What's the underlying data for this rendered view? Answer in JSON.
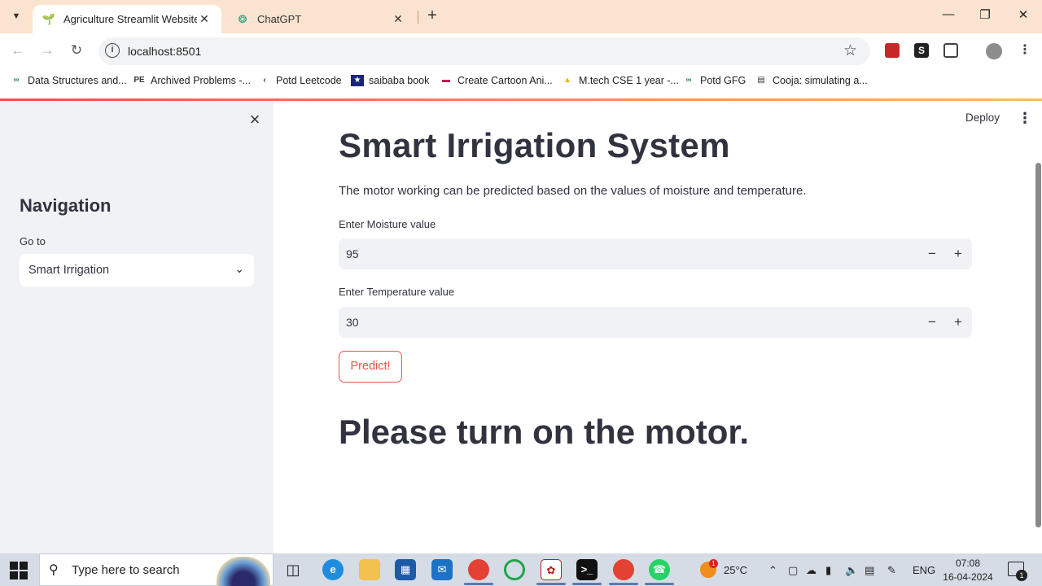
{
  "browser": {
    "tabs": [
      {
        "label": "Agriculture Streamlit Website",
        "active": true,
        "icon": "sprout-icon"
      },
      {
        "label": "ChatGPT",
        "active": false,
        "icon": "openai-icon"
      }
    ],
    "new_tab": "+",
    "url": "localhost:8501",
    "bookmarks": [
      {
        "label": "Data Structures and...",
        "icon": "gfg-icon"
      },
      {
        "label": "Archived Problems -...",
        "icon": "pe-icon"
      },
      {
        "label": "Potd Leetcode",
        "icon": "leetcode-icon"
      },
      {
        "label": "saibaba book",
        "icon": "book-icon"
      },
      {
        "label": "Create Cartoon Ani...",
        "icon": "cartoon-icon"
      },
      {
        "label": "M.tech CSE 1 year -...",
        "icon": "drive-icon"
      },
      {
        "label": "Potd GFG",
        "icon": "gfg-icon"
      },
      {
        "label": "Cooja: simulating a...",
        "icon": "doc-icon"
      }
    ],
    "colors": {
      "tabbar": "#fbe4cf",
      "accent": "#ff4b4b"
    }
  },
  "sidebar": {
    "title": "Navigation",
    "goto_label": "Go to",
    "selected_page": "Smart Irrigation"
  },
  "header": {
    "deploy_label": "Deploy"
  },
  "main": {
    "title": "Smart Irrigation System",
    "description": "The motor working can be predicted based on the values of moisture and temperature.",
    "moisture": {
      "label": "Enter Moisture value",
      "value": "95"
    },
    "temperature": {
      "label": "Enter Temperature value",
      "value": "30"
    },
    "predict_label": "Predict!",
    "result": "Please turn on the motor."
  },
  "taskbar": {
    "search_placeholder": "Type here to search",
    "weather": "25°C",
    "weather_badge": "1",
    "language": "ENG",
    "time": "07:08",
    "date": "16-04-2024",
    "notification_count": "1"
  }
}
